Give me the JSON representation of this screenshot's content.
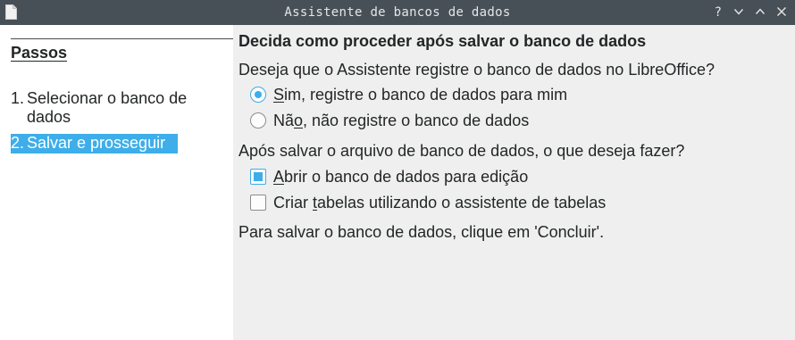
{
  "window": {
    "title": "Assistente de bancos de dados",
    "controls": [
      "help-icon",
      "minimize-icon",
      "maximize-icon",
      "close-icon"
    ],
    "help_label": "?"
  },
  "steps_pane": {
    "heading": "Passos",
    "items": [
      {
        "number": "1.",
        "label": "Selecionar o banco de dados",
        "selected": false
      },
      {
        "number": "2.",
        "label": "Salvar e prosseguir",
        "selected": true
      }
    ]
  },
  "main": {
    "title": "Decida como proceder após salvar o banco de dados",
    "register_question": "Deseja que o Assistente registre o banco de dados no LibreOffice?",
    "register_options": [
      {
        "mnemonic": "S",
        "rest": "im, registre o banco de dados para mim",
        "checked": true
      },
      {
        "pre": "Nã",
        "mnemonic": "o",
        "rest": ", não registre o banco de dados",
        "checked": false
      }
    ],
    "after_save_question": "Após salvar o arquivo de banco de dados, o que deseja fazer?",
    "after_save_options": [
      {
        "mnemonic": "A",
        "rest": "brir o banco de dados para edição",
        "checked": true
      },
      {
        "pre": "Criar ",
        "mnemonic": "t",
        "rest": "abelas utilizando o assistente de tabelas",
        "checked": false
      }
    ],
    "footer_hint": "Para salvar o banco de dados, clique em 'Concluir'."
  },
  "colors": {
    "titlebar": "#475057",
    "accent": "#3daee9",
    "pane_left": "#ffffff",
    "pane_right": "#efefef",
    "text": "#232627"
  }
}
